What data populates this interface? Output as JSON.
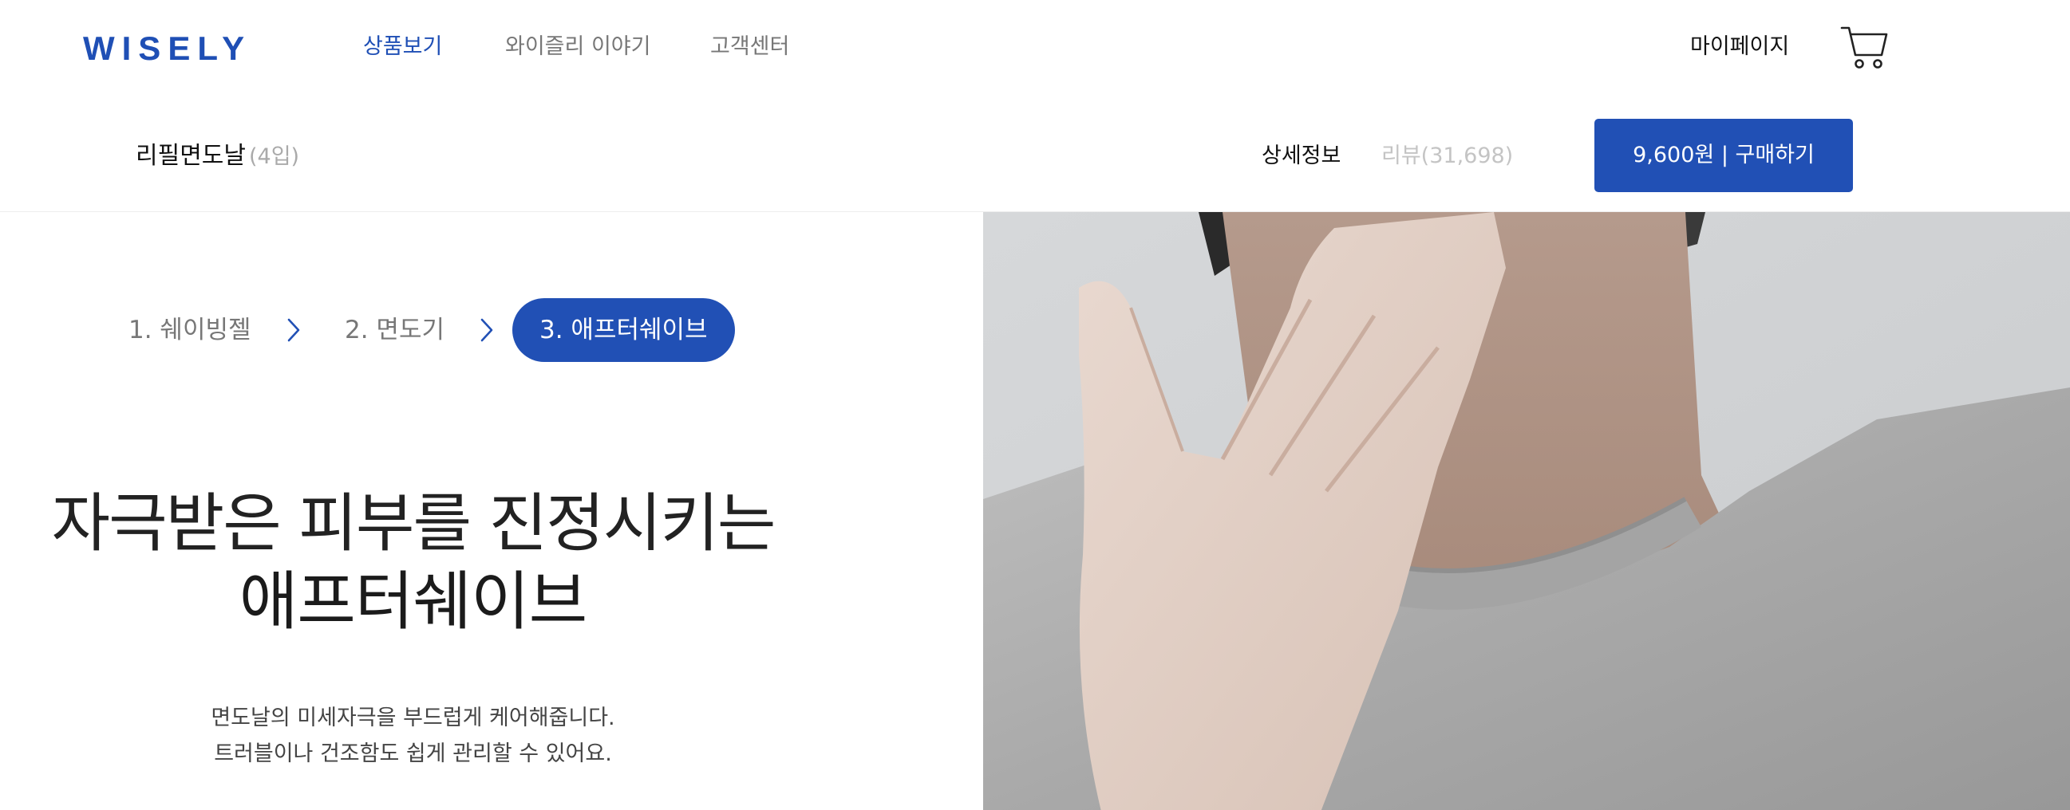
{
  "header": {
    "logo": "WISELY",
    "nav": [
      {
        "label": "상품보기",
        "active": true
      },
      {
        "label": "와이즐리 이야기",
        "active": false
      },
      {
        "label": "고객센터",
        "active": false
      }
    ],
    "mypage_label": "마이페이지",
    "cart_icon": "cart-icon"
  },
  "product": {
    "name": "리필면도날",
    "qty": "(4입)",
    "tabs": {
      "detail": "상세정보",
      "review": "리뷰(31,698)"
    },
    "buy_label": "9,600원 | 구매하기"
  },
  "steps": [
    {
      "label": "1. 쉐이빙젤",
      "active": false
    },
    {
      "label": "2. 면도기",
      "active": false
    },
    {
      "label": "3. 애프터쉐이브",
      "active": true
    }
  ],
  "hero": {
    "headline_line1": "자극받은 피부를 진정시키는",
    "headline_line2": "애프터쉐이브",
    "desc_line1": "면도날의 미세자극을 부드럽게 케어해줍니다.",
    "desc_line2": "트러블이나 건조함도 쉽게 관리할 수 있어요."
  },
  "colors": {
    "brand": "#1f4fb5",
    "button": "#2150b5",
    "nav_inactive": "#777777",
    "review_tab": "#c4c4c4"
  }
}
